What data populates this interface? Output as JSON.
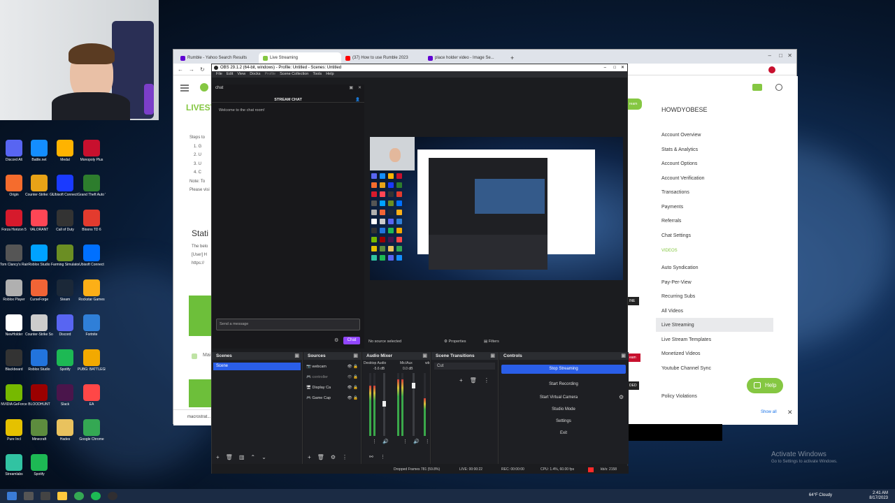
{
  "colors": {
    "accent": "#2a5ee8",
    "rumble": "#85c742",
    "twitch": "#9146ff",
    "recording": "#ff2a2a"
  },
  "desktop": {
    "icons": [
      {
        "label": "Discord Alt",
        "color": "#5865f2",
        "icon": "app-icon"
      },
      {
        "label": "Battle.net",
        "color": "#148eff",
        "icon": "app-icon"
      },
      {
        "label": "Medal",
        "color": "#ffb300",
        "icon": "app-icon"
      },
      {
        "label": "Monopoly Plus",
        "color": "#c8102e",
        "icon": "app-icon"
      },
      {
        "label": "Origin",
        "color": "#f56c2d",
        "icon": "app-icon"
      },
      {
        "label": "Counter-Strike: Global Offe...",
        "color": "#e8a317",
        "icon": "app-icon"
      },
      {
        "label": "Ubisoft Connect",
        "color": "#1a3aff",
        "icon": "app-icon"
      },
      {
        "label": "Grand Theft Auto V",
        "color": "#2d7d2d",
        "icon": "app-icon"
      },
      {
        "label": "Forza Horizon 5",
        "color": "#d61a2c",
        "icon": "app-icon"
      },
      {
        "label": "VALORANT",
        "color": "#ff4655",
        "icon": "app-icon"
      },
      {
        "label": "Call of Duty",
        "color": "#333333",
        "icon": "app-icon"
      },
      {
        "label": "Bloons TD 6",
        "color": "#e33b2e",
        "icon": "app-icon"
      },
      {
        "label": "Tom Clancy's Rainbow Six",
        "color": "#555555",
        "icon": "app-icon"
      },
      {
        "label": "Roblox Studio",
        "color": "#00a2ff",
        "icon": "app-icon"
      },
      {
        "label": "Farming Simulator 17",
        "color": "#6b8e23",
        "icon": "app-icon"
      },
      {
        "label": "Ubisoft Connect",
        "color": "#0070ff",
        "icon": "app-icon"
      },
      {
        "label": "Roblox Player",
        "color": "#b0b0b0",
        "icon": "app-icon"
      },
      {
        "label": "CurseForge",
        "color": "#f16436",
        "icon": "app-icon"
      },
      {
        "label": "Steam",
        "color": "#1b2838",
        "icon": "app-icon"
      },
      {
        "label": "Rockstar Games",
        "color": "#fcaf17",
        "icon": "app-icon"
      },
      {
        "label": "NewHolder",
        "color": "#ffffff",
        "icon": "app-icon"
      },
      {
        "label": "Counter-Strike Source",
        "color": "#cccccc",
        "icon": "app-icon"
      },
      {
        "label": "Discord",
        "color": "#5865f2",
        "icon": "app-icon"
      },
      {
        "label": "Fortnite",
        "color": "#2f7fd8",
        "icon": "app-icon"
      },
      {
        "label": "Blackboard",
        "color": "#333333",
        "icon": "app-icon"
      },
      {
        "label": "Roblox Studio",
        "color": "#2274dd",
        "icon": "app-icon"
      },
      {
        "label": "Spotify",
        "color": "#1db954",
        "icon": "app-icon"
      },
      {
        "label": "PUBG: BATTLEGROUNDS",
        "color": "#f2a900",
        "icon": "app-icon"
      },
      {
        "label": "NVIDIA GeForce",
        "color": "#76b900",
        "icon": "app-icon"
      },
      {
        "label": "BLOODHUNT",
        "color": "#9b0000",
        "icon": "app-icon"
      },
      {
        "label": "Slack",
        "color": "#4a154b",
        "icon": "app-icon"
      },
      {
        "label": "EA",
        "color": "#ff4747",
        "icon": "app-icon"
      },
      {
        "label": "Pure Incl",
        "color": "#e5c100",
        "icon": "app-icon"
      },
      {
        "label": "Minecraft",
        "color": "#5d8c3e",
        "icon": "app-icon"
      },
      {
        "label": "Hades",
        "color": "#e9c25e",
        "icon": "app-icon"
      },
      {
        "label": "Google Chrome",
        "color": "#34a853",
        "icon": "app-icon"
      },
      {
        "label": "Streamlabs",
        "color": "#31c3a2",
        "icon": "app-icon"
      },
      {
        "label": "Spotify",
        "color": "#1db954",
        "icon": "app-icon"
      }
    ]
  },
  "taskbar": {
    "weather": "64°F Cloudy",
    "time": "2:41 AM",
    "date": "8/17/2023"
  },
  "browser": {
    "tabs": [
      {
        "label": "Rumble - Yahoo Search Results",
        "color": "#6001d2"
      },
      {
        "label": "Live Streaming",
        "color": "#85c742"
      },
      {
        "label": "(37) How to use Rumble 2023",
        "color": "#ff0000"
      },
      {
        "label": "place holder video - Image Se...",
        "color": "#6001d2"
      }
    ],
    "new_tab": "+",
    "rumble": {
      "live_heading": "LIVEST",
      "steps": [
        "Steps to",
        "1. G",
        "2. U",
        "3. U",
        "4. C",
        "Note: To",
        "Please visi"
      ],
      "static_heading": "Stati",
      "static_text": [
        "The belo",
        "[User] H",
        "https://"
      ],
      "user_partial": "Mai",
      "stream_btn": "ream",
      "username": "HOWDYOBESE",
      "menu": [
        "Account Overview",
        "Stats & Analytics",
        "Account Options",
        "Account Verification",
        "Transactions",
        "Payments",
        "Referrals",
        "Chat Settings"
      ],
      "videos_header": "VIDEOS",
      "menu2": [
        "Auto Syndication",
        "Pay-Per-View",
        "Recurring Subs",
        "All Videos",
        "Live Streaming",
        "Live Stream Templates",
        "Monetized Videos",
        "Youtube Channel Sync",
        "Policy Violations"
      ],
      "tag": "INE",
      "tag2": "eam",
      "tag3": "DED",
      "help": "Help",
      "show_all": "Show all",
      "downloads": "macrostrat..."
    }
  },
  "obs": {
    "title": "OBS 29.1.2 (64-bit, windows) - Profile: Untitled - Scenes: Untitled",
    "menu": [
      "File",
      "Edit",
      "View",
      "Docks",
      "Profile",
      "Scene Collection",
      "Tools",
      "Help"
    ],
    "chat": {
      "dock_title": "chat",
      "header": "STREAM CHAT",
      "welcome": "Welcome to the chat room!",
      "placeholder": "Send a message",
      "button": "Chat"
    },
    "no_source": "No source selected",
    "properties": "Properties",
    "filters": "Filters",
    "scenes": {
      "title": "Scenes",
      "items": [
        "Scene"
      ]
    },
    "sources": {
      "title": "Sources",
      "items": [
        "webcam",
        "controller",
        "Display Ca",
        "Game Cap"
      ]
    },
    "audio": {
      "title": "Audio Mixer",
      "channels": [
        {
          "name": "Desktop Audio",
          "db": "-5.6 dB",
          "level": 0.8
        },
        {
          "name": "Mic/Aux",
          "db": "0.0 dB",
          "level": 0.9
        },
        {
          "name": "wb",
          "db": "",
          "level": 0.6
        }
      ]
    },
    "transitions": {
      "title": "Scene Transitions",
      "value": "Cut"
    },
    "controls": {
      "title": "Controls",
      "buttons": [
        "Stop Streaming",
        "Start Recording",
        "Start Virtual Camera",
        "Studio Mode",
        "Settings",
        "Exit"
      ]
    },
    "status": {
      "dropped": "Dropped Frames 781 (59.8%)",
      "live": "LIVE: 00:00:22",
      "rec": "REC: 00:00:00",
      "cpu": "CPU: 1.4%, 60.00 fps",
      "kbps": "kb/s: 2158"
    }
  },
  "watermark": {
    "line1": "Activate Windows",
    "line2": "Go to Settings to activate Windows."
  }
}
